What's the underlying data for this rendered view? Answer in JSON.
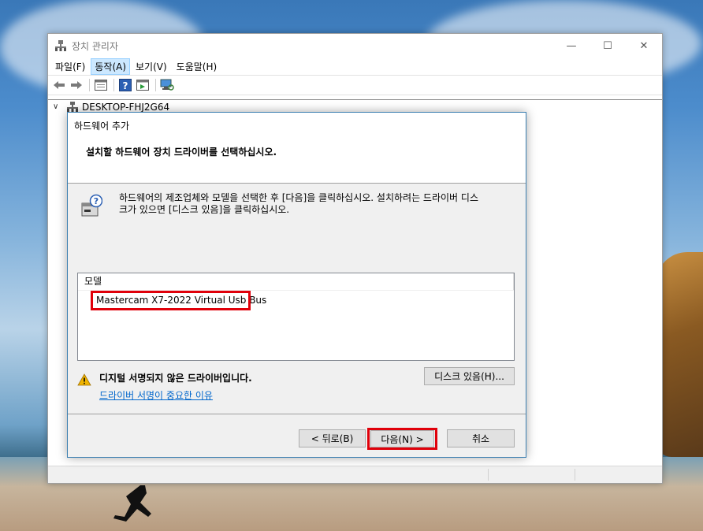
{
  "window": {
    "title": "장치 관리자",
    "controls": {
      "minimize": "—",
      "maximize": "☐",
      "close": "✕"
    }
  },
  "menu": {
    "items": [
      {
        "label": "파일(F)"
      },
      {
        "label": "동작(A)"
      },
      {
        "label": "보기(V)"
      },
      {
        "label": "도움말(H)"
      }
    ]
  },
  "tree": {
    "root_label": "DESKTOP-FHJ2G64"
  },
  "dialog": {
    "title": "하드웨어 추가",
    "heading": "설치할 하드웨어 장치 드라이버를 선택하십시오.",
    "info_line1": "하드웨어의 제조업체와 모델을 선택한 후 [다음]을 클릭하십시오. 설치하려는 드라이버 디스",
    "info_line2": "크가 있으면 [디스크 있음]을 클릭하십시오.",
    "model_header": "모델",
    "model_item": "Mastercam X7-2022 Virtual Usb Bus",
    "warning_text": "디지털 서명되지 않은 드라이버입니다.",
    "warning_link": "드라이버 서명이 중요한 이유",
    "have_disk_label": "디스크 있음(H)...",
    "back_label": "< 뒤로(B)",
    "next_label": "다음(N) >",
    "cancel_label": "취소"
  },
  "colors": {
    "highlight": "#e0000a",
    "link": "#0066cc",
    "menu_active": "#cce8ff"
  }
}
